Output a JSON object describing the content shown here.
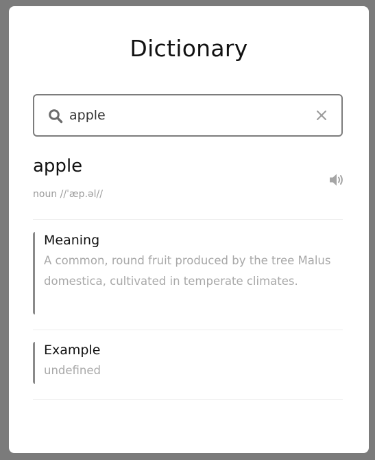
{
  "app": {
    "title": "Dictionary"
  },
  "search": {
    "value": "apple",
    "placeholder": "",
    "icon": "search-icon",
    "clear_icon": "close-icon"
  },
  "entry": {
    "word": "apple",
    "phonetic": "noun //ˈæp.əl//",
    "audio_icon": "speaker-icon"
  },
  "meaning": {
    "heading": "Meaning",
    "text": "A common, round fruit produced by the tree Malus domestica, cultivated in temperate climates."
  },
  "example": {
    "heading": "Example",
    "text": "undefined"
  },
  "colors": {
    "backdrop": "#7b7b7b",
    "card": "#ffffff",
    "muted_text": "#a8a8a8",
    "accent_border": "#8a8a8a"
  }
}
